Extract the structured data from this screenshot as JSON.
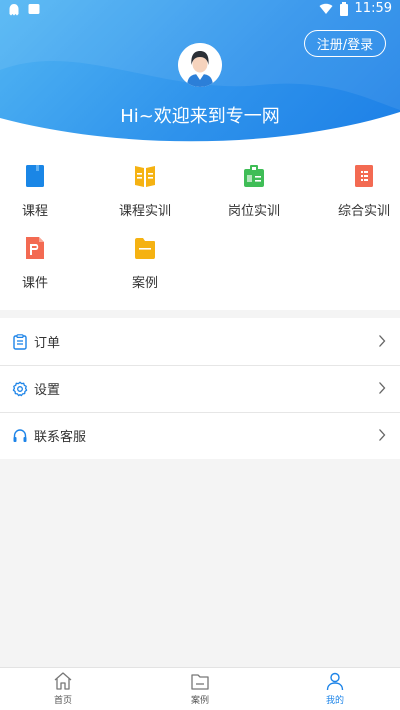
{
  "status_bar": {
    "time": "11:59"
  },
  "header": {
    "register_label": "注册/登录",
    "welcome": "Hi~欢迎来到专一网"
  },
  "grid": [
    {
      "label": "课程",
      "icon": "course-icon",
      "color": "#1a86e6"
    },
    {
      "label": "课程实训",
      "icon": "course-practice-icon",
      "color": "#f5b212"
    },
    {
      "label": "岗位实训",
      "icon": "job-practice-icon",
      "color": "#3fbd56"
    },
    {
      "label": "综合实训",
      "icon": "comprehensive-practice-icon",
      "color": "#f36a52"
    },
    {
      "label": "课件",
      "icon": "courseware-icon",
      "color": "#f36a52"
    },
    {
      "label": "案例",
      "icon": "case-icon",
      "color": "#f5b212"
    }
  ],
  "menu": [
    {
      "label": "订单",
      "icon": "order-icon"
    },
    {
      "label": "设置",
      "icon": "settings-icon"
    },
    {
      "label": "联系客服",
      "icon": "headset-icon"
    }
  ],
  "tabs": [
    {
      "label": "首页",
      "icon": "home-icon",
      "active": false
    },
    {
      "label": "案例",
      "icon": "folder-icon",
      "active": false
    },
    {
      "label": "我的",
      "icon": "user-icon",
      "active": true
    }
  ],
  "colors": {
    "accent": "#1d84e8",
    "header_start": "#52b6f3",
    "header_end": "#1c7fe6"
  }
}
